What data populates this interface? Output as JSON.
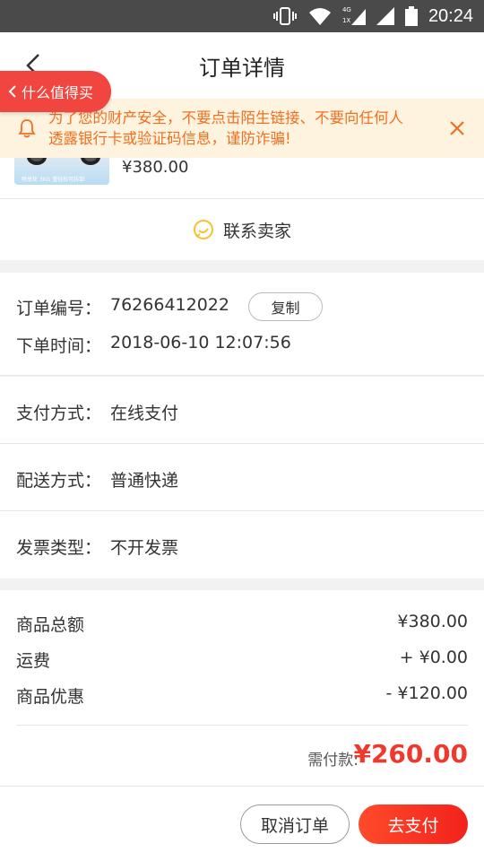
{
  "status_bar": {
    "time": "20:24",
    "network_label_top": "4G",
    "network_label_bottom": "1X"
  },
  "header": {
    "title": "订单详情"
  },
  "floating_pill": {
    "label": "什么值得买"
  },
  "warning": {
    "line1": "为了您的财产安全，不要点击陌生链接、不要向任何人",
    "line2": "透露银行卡或验证码信息，谨防诈骗!"
  },
  "product": {
    "price": "¥380.00",
    "thumb_caption": "畅享轮 3KG 重轻松可拆卸"
  },
  "contact": {
    "label": "联系卖家"
  },
  "order": {
    "number_label": "订单编号：",
    "number_value": "76266412022",
    "copy_label": "复制",
    "time_label": "下单时间：",
    "time_value": "2018-06-10 12:07:56"
  },
  "details": [
    {
      "label": "支付方式：",
      "value": "在线支付"
    },
    {
      "label": "配送方式：",
      "value": "普通快递"
    },
    {
      "label": "发票类型：",
      "value": "不开发票"
    }
  ],
  "summary": {
    "rows": [
      {
        "label": "商品总额",
        "value": "¥380.00"
      },
      {
        "label": "运费",
        "value": "+ ¥0.00"
      },
      {
        "label": "商品优惠",
        "value": "- ¥120.00"
      }
    ],
    "due_label": "需付款:",
    "due_value": "¥260.00"
  },
  "actions": {
    "cancel_label": "取消订单",
    "pay_label": "去支付"
  },
  "colors": {
    "accent": "#ee3a2c",
    "warning_text": "#f07020",
    "warning_bg": "#fdf3df",
    "status_bar": "#4a4a4a"
  }
}
